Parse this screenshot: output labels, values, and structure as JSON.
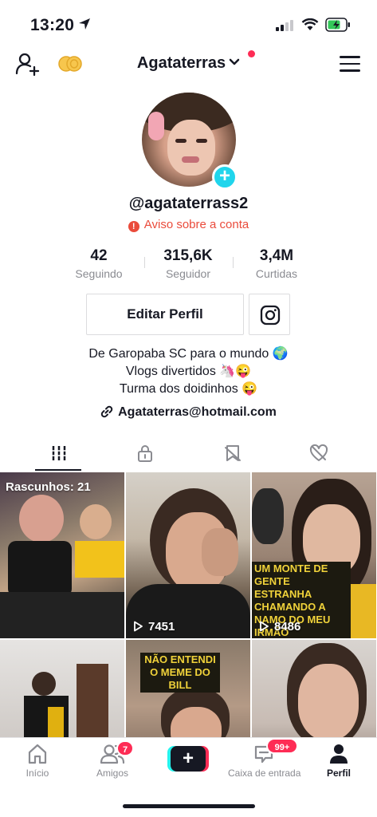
{
  "status_bar": {
    "time": "13:20"
  },
  "header": {
    "title": "Agataterras"
  },
  "profile": {
    "handle": "@agataterrass2",
    "warning": "Aviso sobre a conta",
    "stats": [
      {
        "value": "42",
        "label": "Seguindo"
      },
      {
        "value": "315,6K",
        "label": "Seguidor"
      },
      {
        "value": "3,4M",
        "label": "Curtidas"
      }
    ],
    "edit_button": "Editar Perfil",
    "bio": [
      "De Garopaba SC para o mundo 🌍",
      "Vlogs divertidos 🦄😜",
      "Turma dos doidinhos 😜"
    ],
    "link": "Agataterras@hotmail.com"
  },
  "tabs": [
    {
      "icon": "grid-icon",
      "active": true
    },
    {
      "icon": "lock-icon",
      "active": false
    },
    {
      "icon": "bookmark-hidden-icon",
      "active": false
    },
    {
      "icon": "heart-hidden-icon",
      "active": false
    }
  ],
  "videos": [
    {
      "draft_label": "Rascunhos: 21",
      "views": ""
    },
    {
      "views": "7451"
    },
    {
      "views": "8486",
      "caption": "UM MONTE DE GENTE ESTRANHA CHAMANDO A NAMO DO MEU IRMÃO"
    },
    {
      "views": ""
    },
    {
      "views": "",
      "caption": "NÃO ENTENDI O MEME DO BILL"
    },
    {
      "views": ""
    }
  ],
  "bottom_nav": {
    "items": [
      {
        "label": "Início",
        "icon": "home-icon"
      },
      {
        "label": "Amigos",
        "icon": "friends-icon",
        "badge": "7"
      },
      {
        "label": "",
        "icon": "create-icon"
      },
      {
        "label": "Caixa de entrada",
        "icon": "inbox-icon",
        "badge": "99+"
      },
      {
        "label": "Perfil",
        "icon": "profile-icon"
      }
    ]
  },
  "colors": {
    "accent_red": "#fe2c55",
    "warning": "#ea4b3b",
    "cyan": "#25f4ee",
    "caption_yellow": "#f0d23a"
  }
}
